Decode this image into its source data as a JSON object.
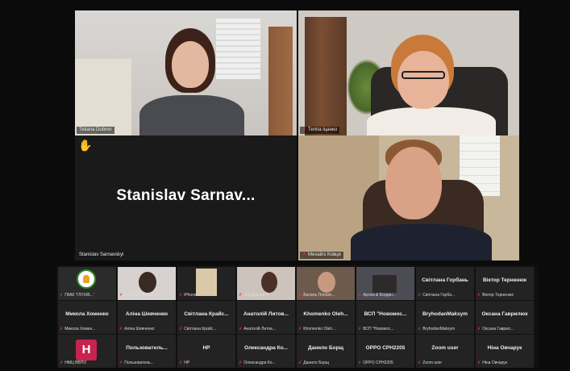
{
  "main_tiles": [
    {
      "name": "Tetiana Dubner"
    },
    {
      "name": "Теппа Іцаниз"
    },
    {
      "name": "Stanislav Sarnavskyi",
      "display_name": "Stanislav  Sarnav..."
    },
    {
      "name": "Mexaiirs Ковця"
    }
  ],
  "gallery": [
    {
      "name": "",
      "tag": "ГВАК 'ГЛУХІВ...'",
      "kind": "logo"
    },
    {
      "name": "",
      "tag": "Lesia Shcherbin...",
      "kind": "video"
    },
    {
      "name": "",
      "tag": "iPhone",
      "kind": "video"
    },
    {
      "name": "",
      "tag": "Ірія Дудник Л",
      "kind": "video"
    },
    {
      "name": "",
      "tag": "Василь Поповч...",
      "kind": "video"
    },
    {
      "name": "",
      "tag": "Артем & Богдан...",
      "kind": "video"
    },
    {
      "name": "Світлана Горбань",
      "tag": "Світлана Горба...",
      "kind": "text"
    },
    {
      "name": "Віктор Терненюк",
      "tag": "Віктор Терненюк",
      "kind": "text"
    },
    {
      "name": "Микола Хоменко",
      "tag": "Микола Хомен...",
      "kind": "text"
    },
    {
      "name": "Аліна Шевченко",
      "tag": "Аліна Шевченко",
      "kind": "text"
    },
    {
      "name": "Світлана Крайс...",
      "tag": "Світлана Крайс...",
      "kind": "text"
    },
    {
      "name": "Анатолій Литов...",
      "tag": "Анатолій Литов...",
      "kind": "text"
    },
    {
      "name": "Khomenko Oleh...",
      "tag": "Khomenko Oleh...",
      "kind": "text"
    },
    {
      "name": "ВСП \"Новомос...",
      "tag": "ВСП \"Новомос...",
      "kind": "text"
    },
    {
      "name": "BryhodanMaksym",
      "tag": "BryhodanMaksym",
      "kind": "text"
    },
    {
      "name": "Оксана Гаврилюк",
      "tag": "Оксана Гаврил...",
      "kind": "text"
    },
    {
      "name": "",
      "tag": "НМЦ ВВПО",
      "kind": "avatar",
      "avatar_letter": "H"
    },
    {
      "name": "Пользователь...",
      "tag": "Пользователь...",
      "kind": "text"
    },
    {
      "name": "HP",
      "tag": "HP",
      "kind": "text"
    },
    {
      "name": "Олександра Ко...",
      "tag": "Олександра Ко...",
      "kind": "text"
    },
    {
      "name": "Данило Борщ",
      "tag": "Данило Борщ",
      "kind": "text"
    },
    {
      "name": "OPPO CPH2205",
      "tag": "OPPO CPH2205",
      "kind": "text"
    },
    {
      "name": "Zoom user",
      "tag": "Zoom user",
      "kind": "text"
    },
    {
      "name": "Ніна Овчарук",
      "tag": "Ніна Овчарук",
      "kind": "text"
    }
  ],
  "colors": {
    "speaker_border": "#4fae6b",
    "muted_mic": "#e33333",
    "avatar_bg": "#c6244e"
  }
}
